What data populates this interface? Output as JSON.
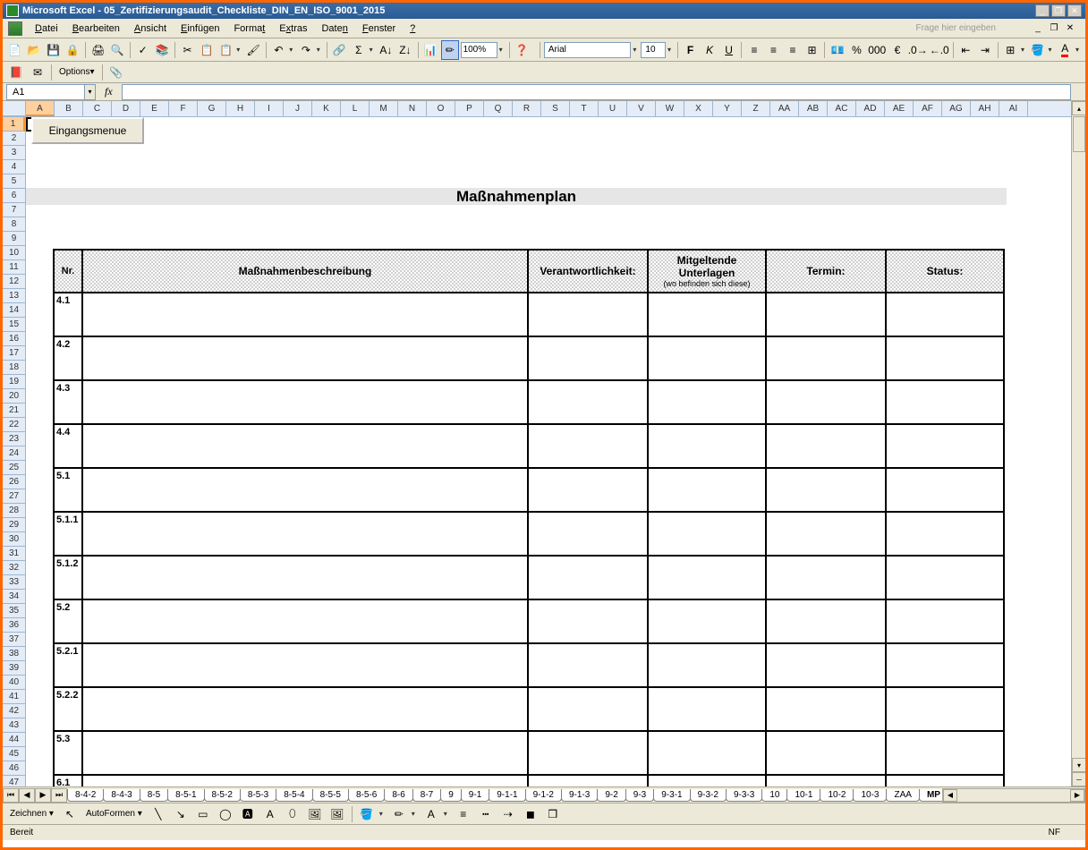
{
  "window": {
    "app": "Microsoft Excel",
    "file": "05_Zertifizierungsaudit_Checkliste_DIN_EN_ISO_9001_2015"
  },
  "menu": {
    "items": [
      "Datei",
      "Bearbeiten",
      "Ansicht",
      "Einfügen",
      "Format",
      "Extras",
      "Daten",
      "Fenster",
      "?"
    ],
    "help_placeholder": "Frage hier eingeben"
  },
  "toolbar": {
    "zoom": "100%",
    "font_name": "Arial",
    "font_size": "10",
    "options_label": "Options"
  },
  "namebox": {
    "cell_ref": "A1",
    "fx": "fx"
  },
  "columns": [
    "A",
    "B",
    "C",
    "D",
    "E",
    "F",
    "G",
    "H",
    "I",
    "J",
    "K",
    "L",
    "M",
    "N",
    "O",
    "P",
    "Q",
    "R",
    "S",
    "T",
    "U",
    "V",
    "W",
    "X",
    "Y",
    "Z",
    "AA",
    "AB",
    "AC",
    "AD",
    "AE",
    "AF",
    "AG",
    "AH",
    "AI"
  ],
  "rows_visible": 47,
  "sheet": {
    "button_label": "Eingangsmenue",
    "title": "Maßnahmenplan",
    "headers": {
      "nr": "Nr.",
      "desc": "Maßnahmenbeschreibung",
      "resp": "Verantwortlichkeit:",
      "docs": "Mitgeltende Unterlagen",
      "docs_sub": "(wo befinden sich diese)",
      "termin": "Termin:",
      "status": "Status:"
    },
    "rows": [
      {
        "nr": "4.1"
      },
      {
        "nr": "4.2"
      },
      {
        "nr": "4.3"
      },
      {
        "nr": "4.4"
      },
      {
        "nr": "5.1"
      },
      {
        "nr": "5.1.1"
      },
      {
        "nr": "5.1.2"
      },
      {
        "nr": "5.2"
      },
      {
        "nr": "5.2.1"
      },
      {
        "nr": "5.2.2"
      },
      {
        "nr": "5.3"
      },
      {
        "nr": "6.1"
      }
    ]
  },
  "tabs": [
    "8-4-2",
    "8-4-3",
    "8-5",
    "8-5-1",
    "8-5-2",
    "8-5-3",
    "8-5-4",
    "8-5-5",
    "8-5-6",
    "8-6",
    "8-7",
    "9",
    "9-1",
    "9-1-1",
    "9-1-2",
    "9-1-3",
    "9-2",
    "9-3",
    "9-3-1",
    "9-3-2",
    "9-3-3",
    "10",
    "10-1",
    "10-2",
    "10-3",
    "ZAA",
    "MP"
  ],
  "active_tab": "MP",
  "drawbar": {
    "zeichnen": "Zeichnen",
    "autoformen": "AutoFormen"
  },
  "status": {
    "ready": "Bereit",
    "nf": "NF"
  }
}
